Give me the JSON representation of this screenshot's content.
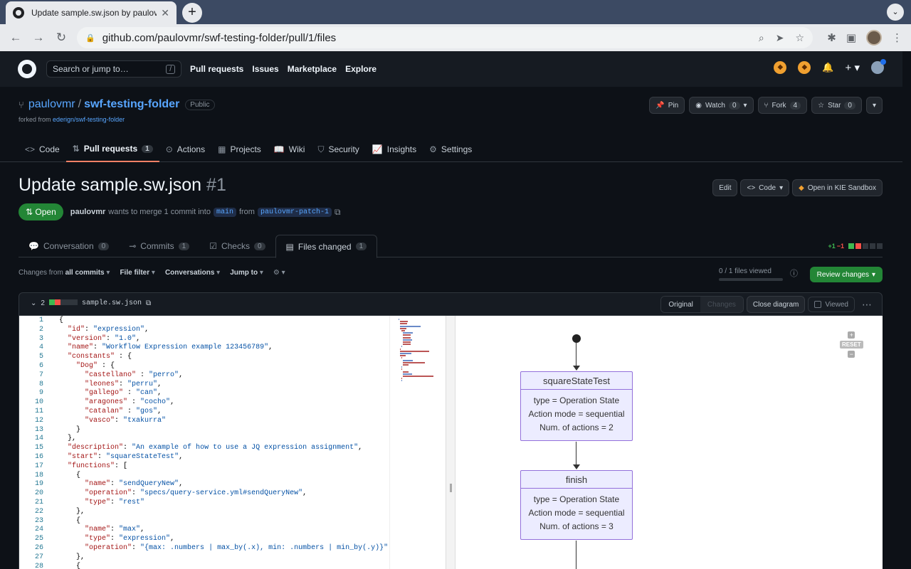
{
  "browser": {
    "tab_title": "Update sample.sw.json by paulovmr",
    "url": "github.com/paulovmr/swf-testing-folder/pull/1/files"
  },
  "gh": {
    "search_placeholder": "Search or jump to…",
    "search_key": "/",
    "nav": [
      "Pull requests",
      "Issues",
      "Marketplace",
      "Explore"
    ]
  },
  "repo": {
    "owner": "paulovmr",
    "name": "swf-testing-folder",
    "visibility": "Public",
    "forked_label": "forked from",
    "forked_from": "ederign/swf-testing-folder",
    "pin": "Pin",
    "watch": "Watch",
    "watch_count": "0",
    "fork": "Fork",
    "fork_count": "4",
    "star": "Star",
    "star_count": "0",
    "nav": [
      {
        "label": "Code",
        "icon": "code-icon"
      },
      {
        "label": "Pull requests",
        "icon": "pull-request-icon",
        "count": "1"
      },
      {
        "label": "Actions",
        "icon": "play-icon"
      },
      {
        "label": "Projects",
        "icon": "table-icon"
      },
      {
        "label": "Wiki",
        "icon": "book-icon"
      },
      {
        "label": "Security",
        "icon": "shield-icon"
      },
      {
        "label": "Insights",
        "icon": "graph-icon"
      },
      {
        "label": "Settings",
        "icon": "gear-icon"
      }
    ]
  },
  "pr": {
    "title": "Update sample.sw.json",
    "number": "#1",
    "edit": "Edit",
    "code": "Code",
    "kie": "Open in KIE Sandbox",
    "state": "Open",
    "author": "paulovmr",
    "wants": "wants to merge 1 commit into",
    "base": "main",
    "from": "from",
    "head": "paulovmr-patch-1",
    "tabs": [
      {
        "label": "Conversation",
        "count": "0"
      },
      {
        "label": "Commits",
        "count": "1"
      },
      {
        "label": "Checks",
        "count": "0"
      },
      {
        "label": "Files changed",
        "count": "1"
      }
    ],
    "diff_plus": "+1",
    "diff_minus": "−1"
  },
  "filter": {
    "changes_from": "Changes from",
    "all_commits": "all commits",
    "file_filter": "File filter",
    "conversations": "Conversations",
    "jump_to": "Jump to",
    "viewed": "0 / 1 files viewed",
    "review": "Review changes"
  },
  "file": {
    "changes": "2",
    "name": "sample.sw.json",
    "original": "Original",
    "changes_btn": "Changes",
    "close_diagram": "Close diagram",
    "viewed": "Viewed"
  },
  "diagram": {
    "reset": "RESET",
    "states": [
      {
        "name": "squareStateTest",
        "type": "type = Operation State",
        "mode": "Action mode = sequential",
        "actions": "Num. of actions = 2"
      },
      {
        "name": "finish",
        "type": "type = Operation State",
        "mode": "Action mode = sequential",
        "actions": "Num. of actions = 3"
      }
    ]
  },
  "code_lines": [
    "{",
    "  \"id\": \"expression\",",
    "  \"version\": \"1.0\",",
    "  \"name\": \"Workflow Expression example 123456789\",",
    "  \"constants\" : {",
    "    \"Dog\" : {",
    "      \"castellano\" : \"perro\",",
    "      \"leones\": \"perru\",",
    "      \"gallego\" : \"can\",",
    "      \"aragones\" : \"cocho\",",
    "      \"catalan\" : \"gos\",",
    "      \"vasco\": \"txakurra\"",
    "    }",
    "  },",
    "  \"description\": \"An example of how to use a JQ expression assignment\",",
    "  \"start\": \"squareStateTest\",",
    "  \"functions\": [",
    "    {",
    "      \"name\": \"sendQueryNew\",",
    "      \"operation\": \"specs/query-service.yml#sendQueryNew\",",
    "      \"type\": \"rest\"",
    "    },",
    "    {",
    "      \"name\": \"max\",",
    "      \"type\": \"expression\",",
    "      \"operation\": \"{max: .numbers | max_by(.x), min: .numbers | min_by(.y)}\"",
    "    },",
    "    {"
  ]
}
